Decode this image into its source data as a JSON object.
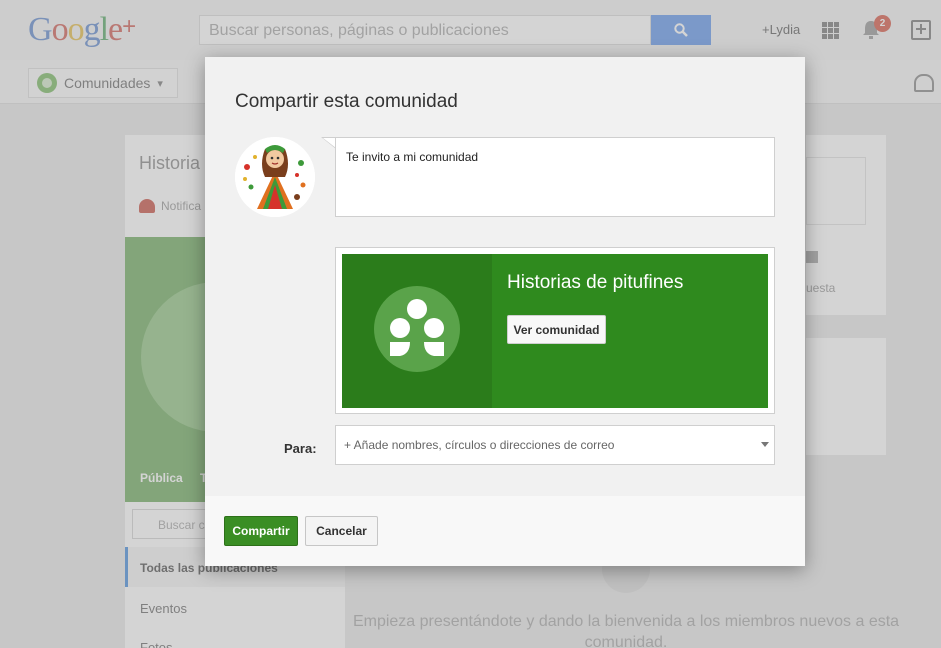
{
  "header": {
    "logo_text": "Google+",
    "search_placeholder": "Buscar personas, páginas o publicaciones",
    "user_link": "+Lydia",
    "notification_count": "2"
  },
  "subbar": {
    "communities_label": "Comunidades"
  },
  "background": {
    "community_title_partial": "Historia",
    "notifications_partial": "Notifica",
    "visibility_label": "Pública",
    "visibility_second_partial": "T",
    "search_partial": "Buscar c",
    "nav_all_posts": "Todas las publicaciones",
    "nav_events": "Eventos",
    "nav_photos_partial": "Fotos",
    "right_panel_partial": "uesta",
    "empty_state_text": "Empieza presentándote y dando la bienvenida a los miembros nuevos a esta comunidad."
  },
  "dialog": {
    "title": "Compartir esta comunidad",
    "message_text": "Te invito a mi comunidad",
    "community_name": "Historias de pitufines",
    "view_community_button": "Ver comunidad",
    "to_label": "Para:",
    "to_placeholder": "+ Añade nombres, círculos o direcciones de correo",
    "share_button": "Compartir",
    "cancel_button": "Cancelar"
  },
  "colors": {
    "community_green": "#2f8a1e",
    "share_button_green": "#3a8e24",
    "search_button_blue": "#4d88e8",
    "notification_red": "#d0402d"
  }
}
